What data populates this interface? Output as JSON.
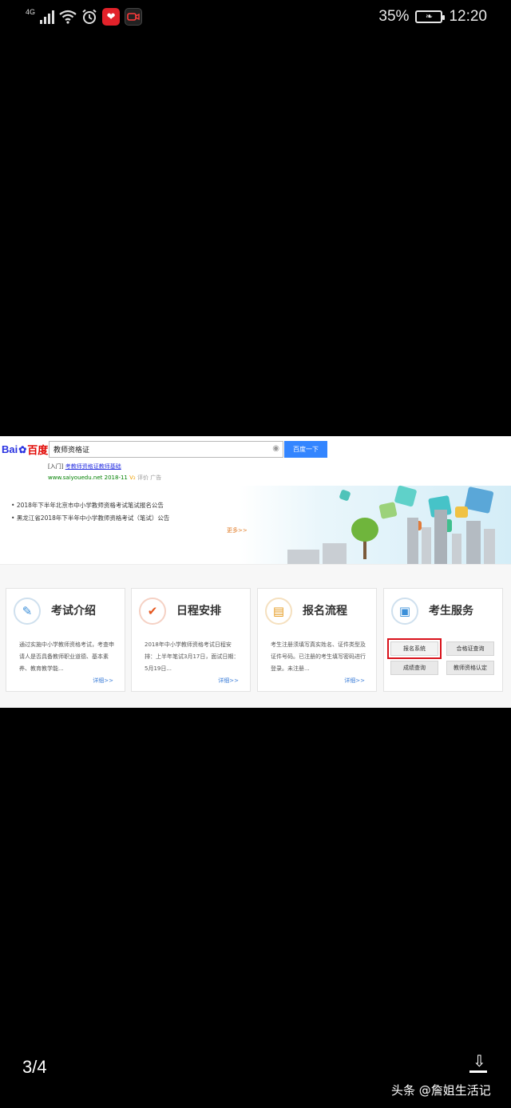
{
  "status_bar": {
    "network": "4G",
    "battery": "35%",
    "time": "12:20",
    "icons": [
      "signal-icon",
      "wifi-icon",
      "alarm-icon",
      "app-red-icon",
      "screen-record-icon",
      "battery-saver-icon"
    ]
  },
  "screenshot": {
    "baidu": {
      "logo_part1": "Bai",
      "logo_part2": "百度",
      "search_query": "教师资格证",
      "search_button": "百度一下"
    },
    "ad": {
      "prefix": "[入门]",
      "title": "考教师资格证教师基础",
      "url": "www.saiyouedu.net",
      "date": "2018-11",
      "v_badge": "V₂",
      "comment": "评价",
      "ad_label": "广告"
    },
    "notices": [
      "2018年下半年北京市中小学教师资格考试笔试报名公告",
      "黑龙江省2018年下半年中小学教师资格考试（笔试）公告"
    ],
    "more": "更多>>",
    "cards": [
      {
        "title": "考试介绍",
        "desc": "通过实施中小学教师资格考试，考查申请人是否具备教师职业道德、基本素养、教育教学能...",
        "more": "详细>>"
      },
      {
        "title": "日程安排",
        "desc": "2018年中小学教师资格考试日程安排：上半年笔试3月17日，面试日期：5月19日...",
        "more": "详细>>"
      },
      {
        "title": "报名流程",
        "desc": "考生注册须填写真实姓名、证件类型及证件号码。已注册的考生填写密码进行登录。未注册...",
        "more": "详细>>"
      },
      {
        "title": "考生服务",
        "buttons": [
          "报名系统",
          "合格证查询",
          "成绩查询",
          "教师资格认定"
        ]
      }
    ],
    "highlight_color": "#d9121b"
  },
  "viewer": {
    "page_indicator": "3/4",
    "watermark": "头条 @詹姐生活记"
  }
}
